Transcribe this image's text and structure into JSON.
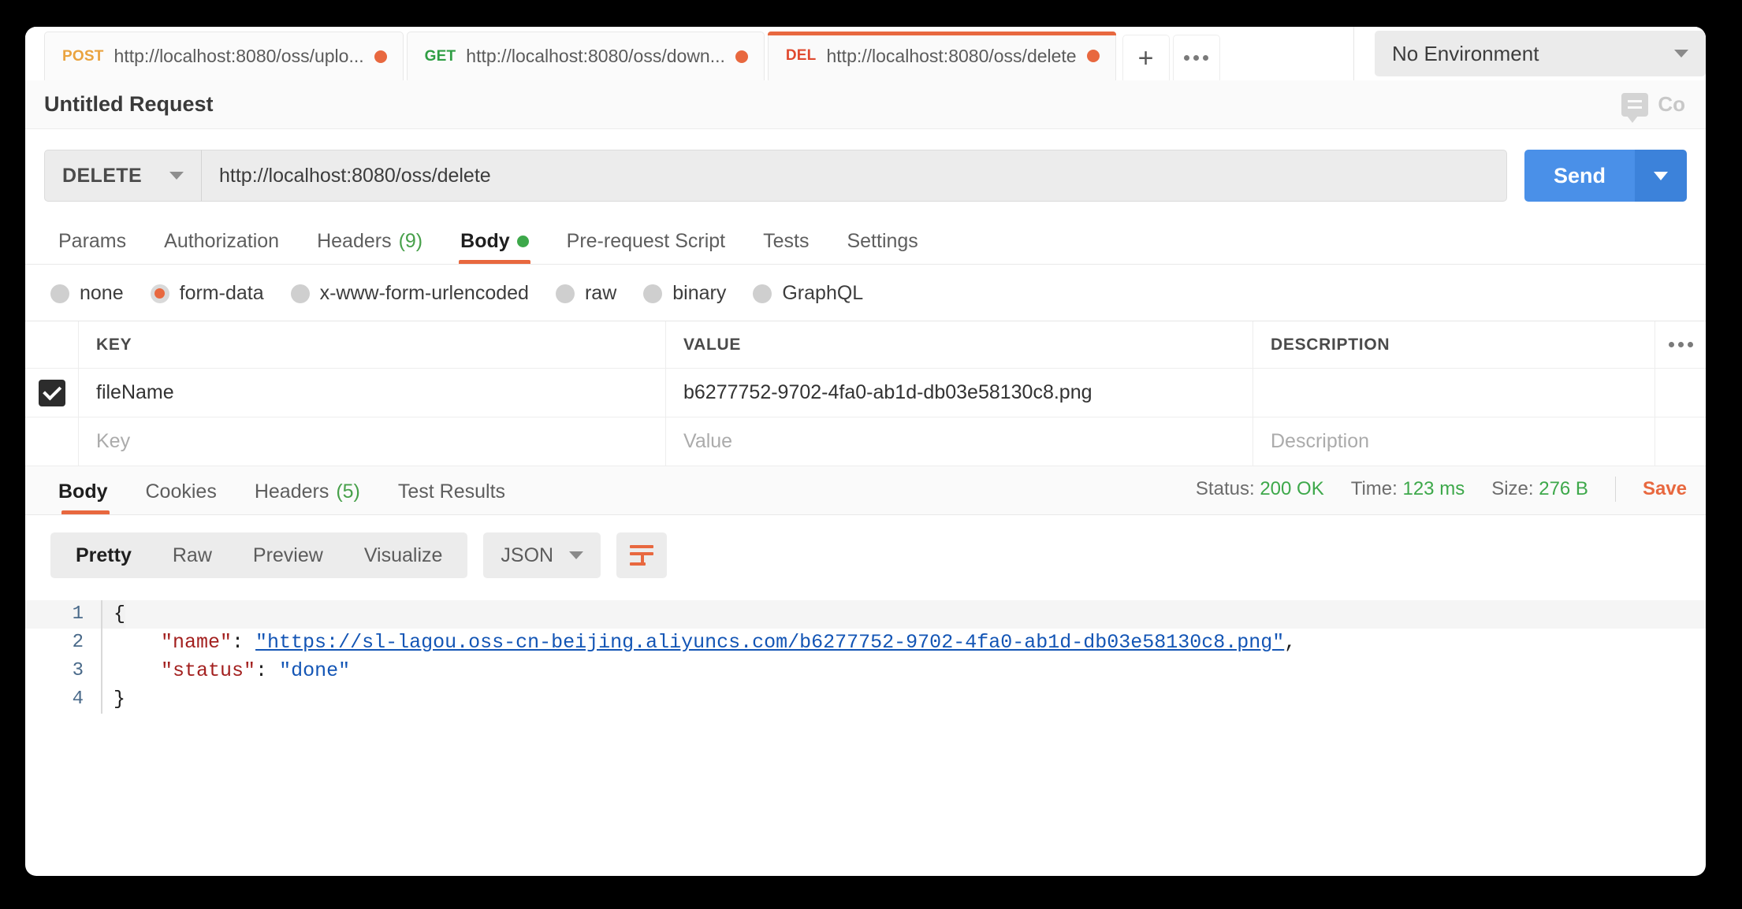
{
  "tabs": [
    {
      "method": "POST",
      "method_class": "m-post",
      "url": "http://localhost:8080/oss/uplo...",
      "unsaved": true,
      "active": false
    },
    {
      "method": "GET",
      "method_class": "m-get",
      "url": "http://localhost:8080/oss/down...",
      "unsaved": true,
      "active": false
    },
    {
      "method": "DEL",
      "method_class": "m-del",
      "url": "http://localhost:8080/oss/delete",
      "unsaved": true,
      "active": true
    }
  ],
  "tabbar": {
    "new_tab_label": "+",
    "more_label": "•••"
  },
  "environment": {
    "selected": "No Environment"
  },
  "title_row": {
    "title": "Untitled Request",
    "comments_label": "Co"
  },
  "request": {
    "method": "DELETE",
    "url": "http://localhost:8080/oss/delete",
    "send_label": "Send"
  },
  "request_tabs": [
    {
      "label": "Params",
      "active": false
    },
    {
      "label": "Authorization",
      "active": false
    },
    {
      "label": "Headers",
      "count": "(9)",
      "active": false
    },
    {
      "label": "Body",
      "dot": true,
      "active": true
    },
    {
      "label": "Pre-request Script",
      "active": false
    },
    {
      "label": "Tests",
      "active": false
    },
    {
      "label": "Settings",
      "active": false
    }
  ],
  "body_types": [
    {
      "label": "none",
      "selected": false
    },
    {
      "label": "form-data",
      "selected": true
    },
    {
      "label": "x-www-form-urlencoded",
      "selected": false
    },
    {
      "label": "raw",
      "selected": false
    },
    {
      "label": "binary",
      "selected": false
    },
    {
      "label": "GraphQL",
      "selected": false
    }
  ],
  "kv_table": {
    "headers": {
      "key": "KEY",
      "value": "VALUE",
      "description": "DESCRIPTION"
    },
    "rows": [
      {
        "checked": true,
        "key": "fileName",
        "value": "b6277752-9702-4fa0-ab1d-db03e58130c8.png",
        "description": ""
      }
    ],
    "placeholders": {
      "key": "Key",
      "value": "Value",
      "description": "Description"
    }
  },
  "response_tabs": [
    {
      "label": "Body",
      "active": true
    },
    {
      "label": "Cookies",
      "active": false
    },
    {
      "label": "Headers",
      "count": "(5)",
      "active": false
    },
    {
      "label": "Test Results",
      "active": false
    }
  ],
  "response_meta": {
    "status_label": "Status:",
    "status_value": "200 OK",
    "time_label": "Time:",
    "time_value": "123 ms",
    "size_label": "Size:",
    "size_value": "276 B",
    "save_label": "Save"
  },
  "response_toolbar": {
    "segments": [
      {
        "label": "Pretty",
        "active": true
      },
      {
        "label": "Raw",
        "active": false
      },
      {
        "label": "Preview",
        "active": false
      },
      {
        "label": "Visualize",
        "active": false
      }
    ],
    "format": "JSON"
  },
  "response_body": {
    "lines": [
      {
        "n": "1",
        "open_brace": "{"
      },
      {
        "n": "2",
        "indent": "    ",
        "key": "\"name\"",
        "colon": ": ",
        "link": "\"https://sl-lagou.oss-cn-beijing.aliyuncs.com/b6277752-9702-4fa0-ab1d-db03e58130c8.png\"",
        "comma": ","
      },
      {
        "n": "3",
        "indent": "    ",
        "key": "\"status\"",
        "colon": ": ",
        "str": "\"done\""
      },
      {
        "n": "4",
        "close_brace": "}"
      }
    ]
  },
  "colors": {
    "accent_orange": "#e8683f",
    "send_blue": "#4a90e8",
    "status_green": "#3da84a",
    "post_yellow": "#eaa33f",
    "get_green": "#2f9e44",
    "del_red": "#e0492f"
  }
}
